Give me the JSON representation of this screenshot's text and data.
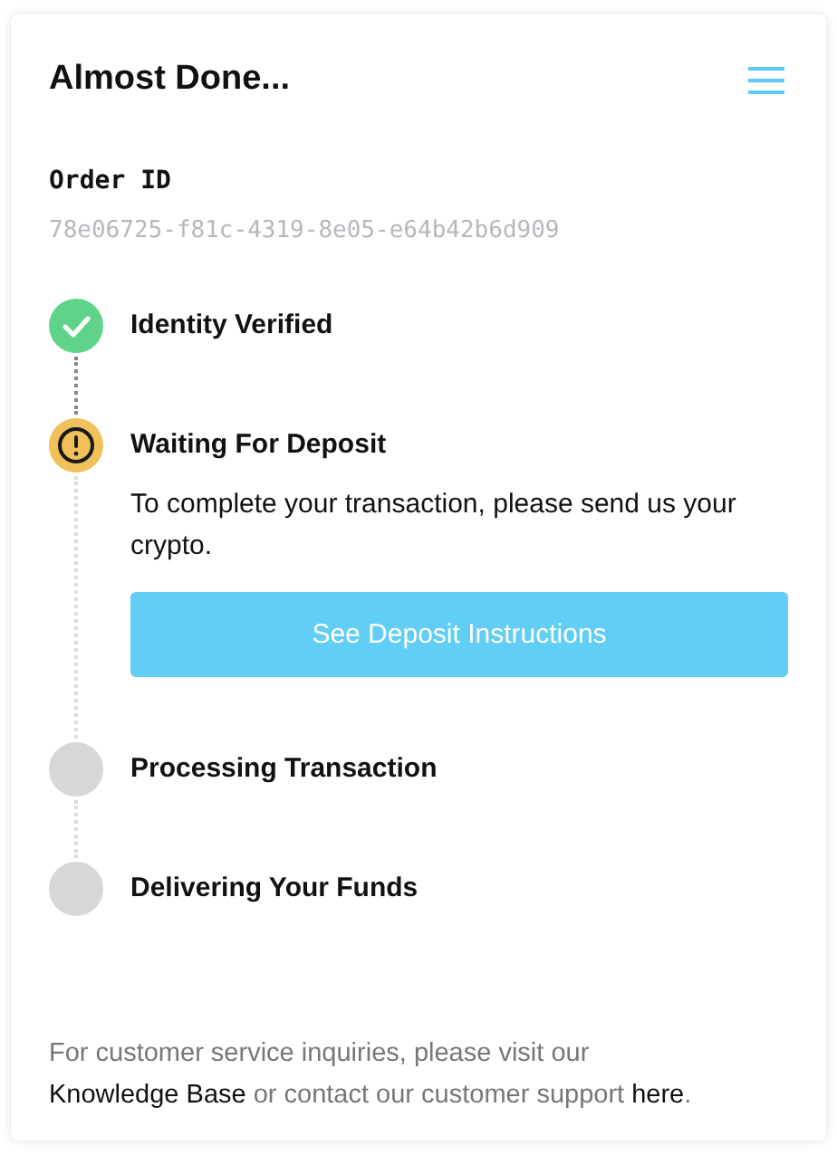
{
  "header": {
    "title": "Almost Done..."
  },
  "order": {
    "label": "Order ID",
    "id": "78e06725-f81c-4319-8e05-e64b42b6d909"
  },
  "steps": [
    {
      "title": "Identity Verified",
      "kind": "done"
    },
    {
      "title": "Waiting For Deposit",
      "kind": "waiting",
      "description": "To complete your transaction, please send us your crypto.",
      "button": "See Deposit Instructions"
    },
    {
      "title": "Processing Transaction",
      "kind": "todo"
    },
    {
      "title": "Delivering Your Funds",
      "kind": "todo"
    }
  ],
  "footer": {
    "text_1": "For customer service inquiries, please visit our ",
    "link_1": "Knowledge Base",
    "text_2": " or contact our customer support ",
    "link_2": "here",
    "text_3": "."
  }
}
